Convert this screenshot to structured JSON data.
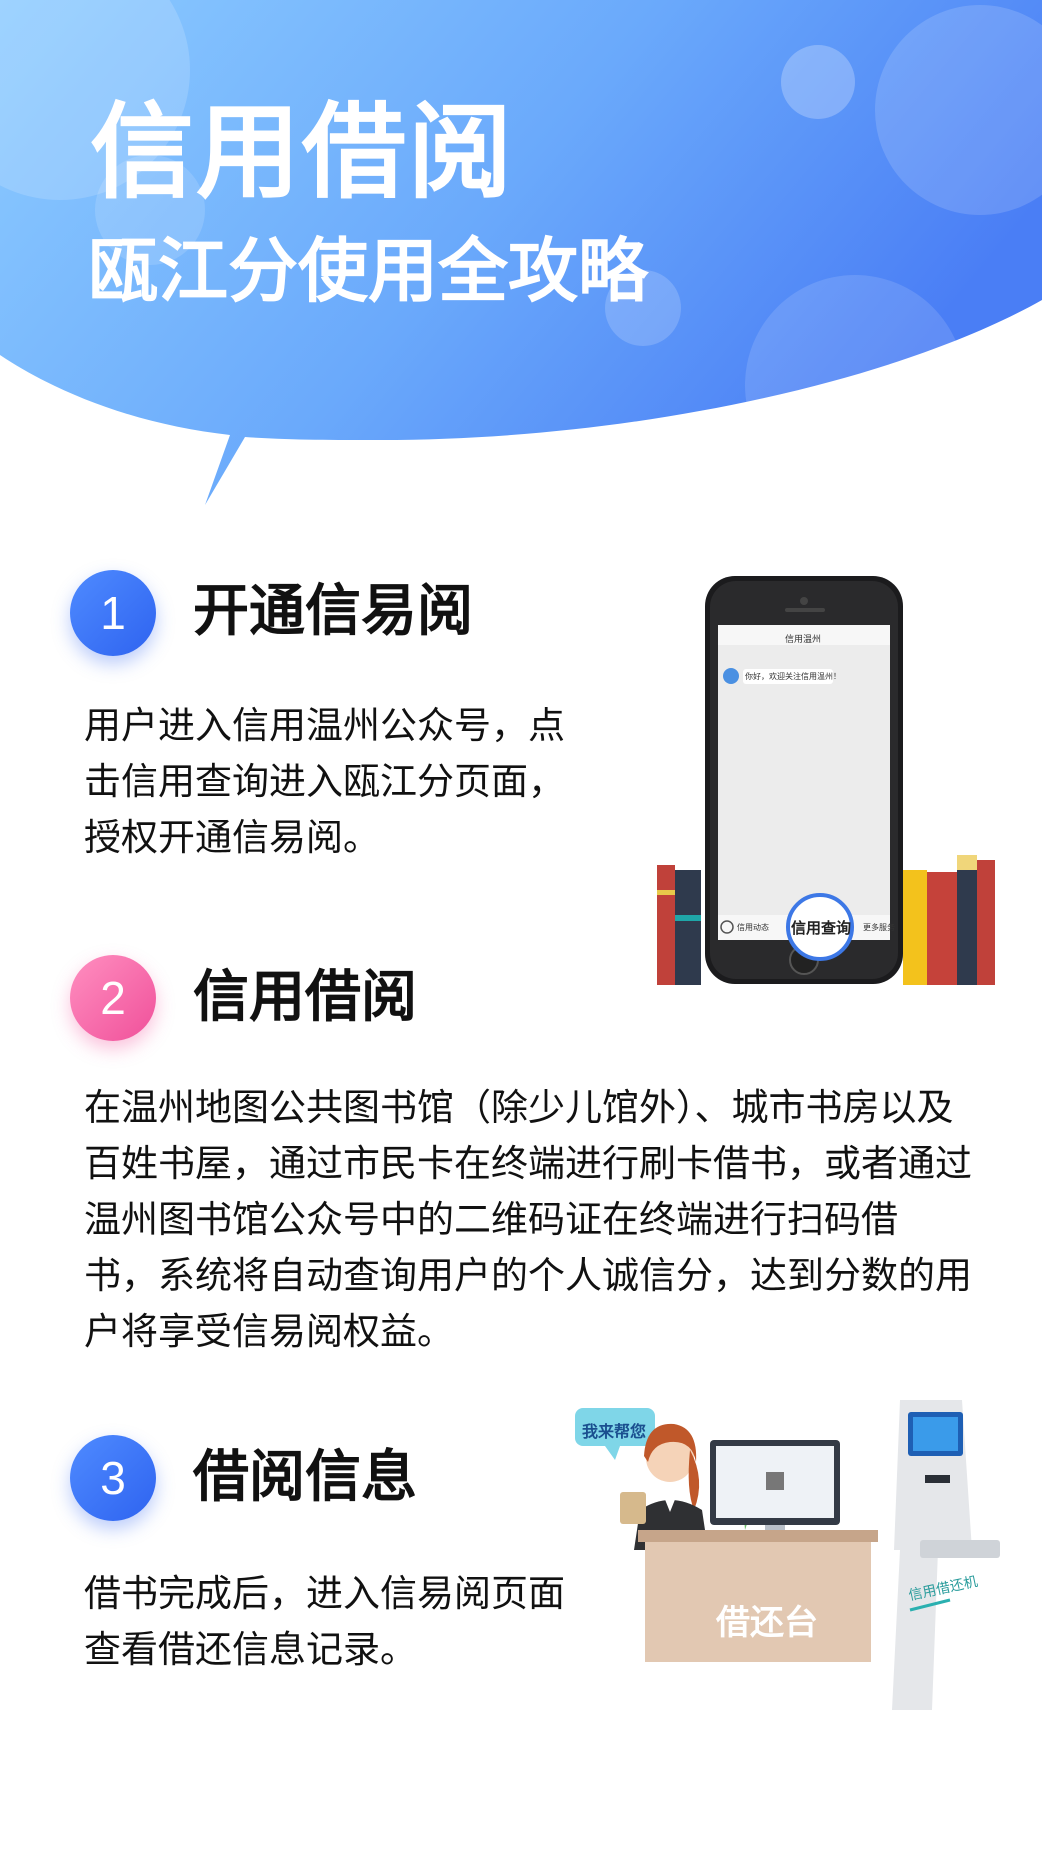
{
  "header": {
    "title": "信用借阅",
    "subtitle": "瓯江分使用全攻略"
  },
  "steps": [
    {
      "number": "1",
      "heading": "开通信易阅",
      "lines": [
        "用户进入信用温州公众号，点",
        "击信用查询进入瓯江分页面，",
        "授权开通信易阅。"
      ]
    },
    {
      "number": "2",
      "heading": "信用借阅",
      "lines": [
        "在温州地图公共图书馆（除少儿馆外）、城市书房以及",
        "百姓书屋，通过市民卡在终端进行刷卡借书，或者通过",
        "温州图书馆公众号中的二维码证在终端进行扫码借",
        "书，系统将自动查询用户的个人诚信分，达到分数的用",
        "户将享受信易阅权益。"
      ]
    },
    {
      "number": "3",
      "heading": "借阅信息",
      "lines": [
        "借书完成后，进入信易阅页面",
        "查看借还信息记录。"
      ]
    }
  ],
  "phone": {
    "app_title": "信用温州",
    "chat_message": "你好，欢迎关注信用温州！",
    "left_menu": "信用动态",
    "center_button": "信用查询",
    "right_menu": "更多服务"
  },
  "desk": {
    "speech_bubble": "我来帮您",
    "counter_label": "借还台",
    "kiosk_label": "信用借还机"
  },
  "colors": {
    "header_light": "#8fd0ff",
    "header_dark": "#4a80f5",
    "badge_blue": "#2e63f0",
    "badge_pink": "#f0509a"
  }
}
